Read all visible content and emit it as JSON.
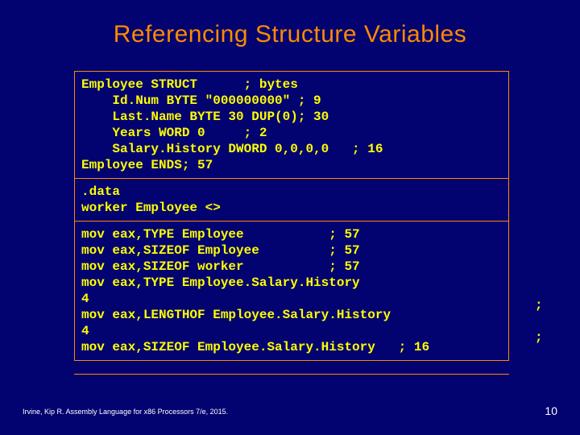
{
  "title": "Referencing Structure Variables",
  "code_top": "Employee STRUCT      ; bytes\n    Id.Num BYTE \"000000000\" ; 9\n    Last.Name BYTE 30 DUP(0); 30\n    Years WORD 0     ; 2\n    Salary.History DWORD 0,0,0,0   ; 16\nEmployee ENDS; 57",
  "code_mid": ".data\nworker Employee <>",
  "code_bot": "mov eax,TYPE Employee           ; 57\nmov eax,SIZEOF Employee         ; 57\nmov eax,SIZEOF worker           ; 57\nmov eax,TYPE Employee.Salary.History\n4\nmov eax,LENGTHOF Employee.Salary.History\n4\nmov eax,SIZEOF Employee.Salary.History   ; 16",
  "over1": ";",
  "over2": ";",
  "footer": "Irvine, Kip R. Assembly Language for x86 Processors 7/e, 2015.",
  "pagenum": "10"
}
